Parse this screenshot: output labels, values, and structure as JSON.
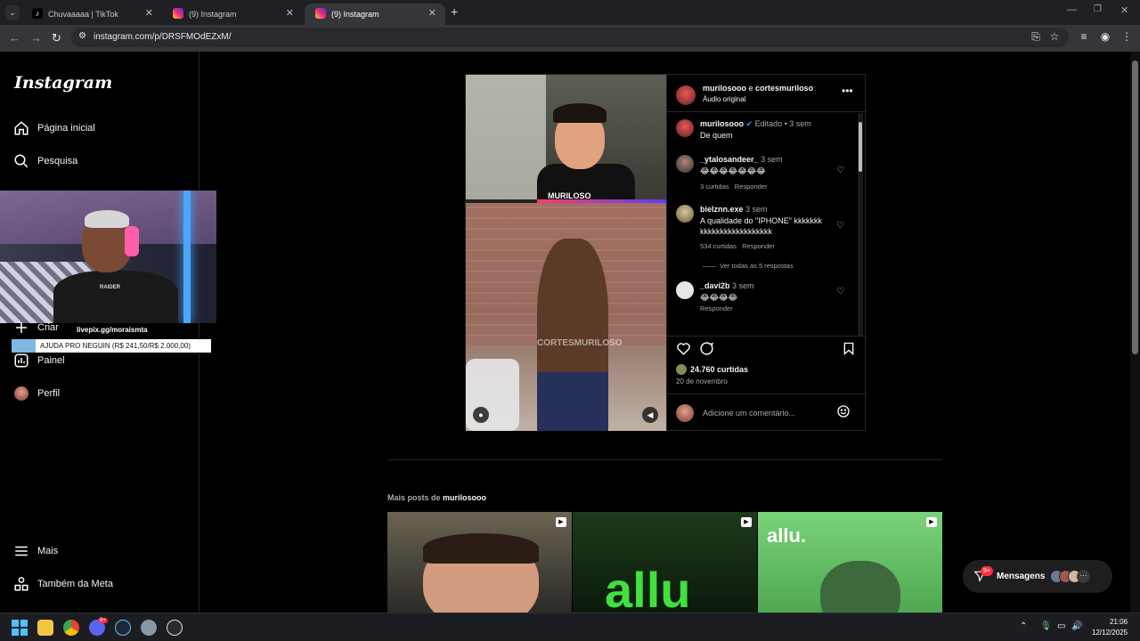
{
  "browser": {
    "tabs": [
      {
        "title": "Chuvaaaaa | TikTok",
        "active": false
      },
      {
        "title": "(9) Instagram",
        "active": false
      },
      {
        "title": "(9) Instagram",
        "active": true
      }
    ],
    "new_tab": "+",
    "url": "instagram.com/p/DRSFMOdEZxM/"
  },
  "sidebar": {
    "logo": "Instagram",
    "items": [
      {
        "label": "Página inicial",
        "icon": "home-icon"
      },
      {
        "label": "Pesquisa",
        "icon": "search-icon"
      },
      {
        "label": "Criar",
        "icon": "plus-icon"
      },
      {
        "label": "Painel",
        "icon": "chart-icon"
      },
      {
        "label": "Perfil",
        "icon": "avatar"
      },
      {
        "label": "Mais",
        "icon": "menu-icon"
      },
      {
        "label": "Também da Meta",
        "icon": "meta-icon"
      }
    ]
  },
  "overlay": {
    "cam_shirt": "RAIDER",
    "link": "livepix.gg/moraismta",
    "goal_text": "AJUDA PRO NEGUIN (R$ 241,50/R$ 2.000,00)",
    "goal_progress": 0.12
  },
  "post": {
    "header_user1": "murilosooo",
    "header_and": "e",
    "header_user2": "cortesmurilo­so",
    "header_audio": "Áudio original",
    "video_top_label": "MURILOSO",
    "video_watermark": "CORTESMURILOSO",
    "caption": {
      "user": "murilosooo",
      "meta": "Editado • 3 sem",
      "text": "De quem"
    },
    "comments": [
      {
        "user": "_ytalosandeer_",
        "time": "3 sem",
        "text": "😂😂😂😂😂😂😂",
        "likes": "3 curtidas",
        "reply": "Responder"
      },
      {
        "user": "bielznn.exe",
        "time": "3 sem",
        "text": "A qualidade do \"IPHONE\" kkkkkkkkkkkkkkkkkkkkkkkkk",
        "likes": "534 curtidas",
        "reply": "Responder",
        "replies_link": "Ver todas as 5 respostas"
      },
      {
        "user": "_davi2b",
        "time": "3 sem",
        "text": "😂😂😂😂",
        "reply": "Responder"
      }
    ],
    "likes_count": "24.760 curtidas",
    "date": "20 de novembro",
    "add_comment_placeholder": "Adicione um comentário..."
  },
  "more_posts": {
    "prefix": "Mais posts de",
    "user": "murilosooo",
    "thumb3_text": "allu."
  },
  "messages": {
    "label": "Mensagens",
    "badge": "9+"
  },
  "taskbar": {
    "time": "21:06",
    "date": "12/12/2025",
    "discord_badge": "9+"
  }
}
